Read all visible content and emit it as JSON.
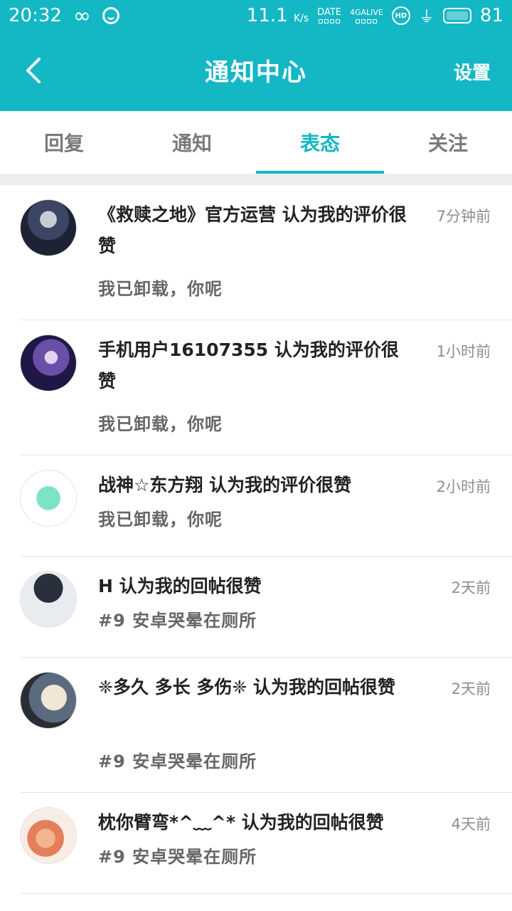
{
  "status_bar": {
    "time": "20:32",
    "speed": "11.1",
    "speed_unit": "K/s",
    "date_label": "DATE",
    "network_label": "4GALIVE",
    "hd_label": "HD",
    "battery": "81"
  },
  "header": {
    "title": "通知中心",
    "settings_label": "设置"
  },
  "tabs": [
    {
      "label": "回复",
      "active": false
    },
    {
      "label": "通知",
      "active": false
    },
    {
      "label": "表态",
      "active": true
    },
    {
      "label": "关注",
      "active": false
    }
  ],
  "notifications": [
    {
      "title": "《救赎之地》官方运营 认为我的评价很赞",
      "time": "7分钟前",
      "subtitle": "我已卸载，你呢"
    },
    {
      "title": "手机用户16107355 认为我的评价很赞",
      "time": "1小时前",
      "subtitle": "我已卸载，你呢"
    },
    {
      "title": "战神☆东方翔 认为我的评价很赞",
      "time": "2小时前",
      "subtitle": "我已卸载，你呢"
    },
    {
      "title": "H 认为我的回帖很赞",
      "time": "2天前",
      "subtitle": "#9 安卓哭晕在厕所"
    },
    {
      "title": "❈多久 多长 多伤❈ 认为我的回帖很赞",
      "time": "2天前",
      "subtitle": "#9 安卓哭晕在厕所"
    },
    {
      "title": "枕你臂弯*^﹏^* 认为我的回帖很赞",
      "time": "4天前",
      "subtitle": "#9 安卓哭晕在厕所"
    }
  ],
  "colors": {
    "accent": "#14b7c4",
    "tab_inactive": "#7a7a7a",
    "title_text": "#222222",
    "sub_text": "#666666",
    "time_text": "#8e8e8e"
  }
}
